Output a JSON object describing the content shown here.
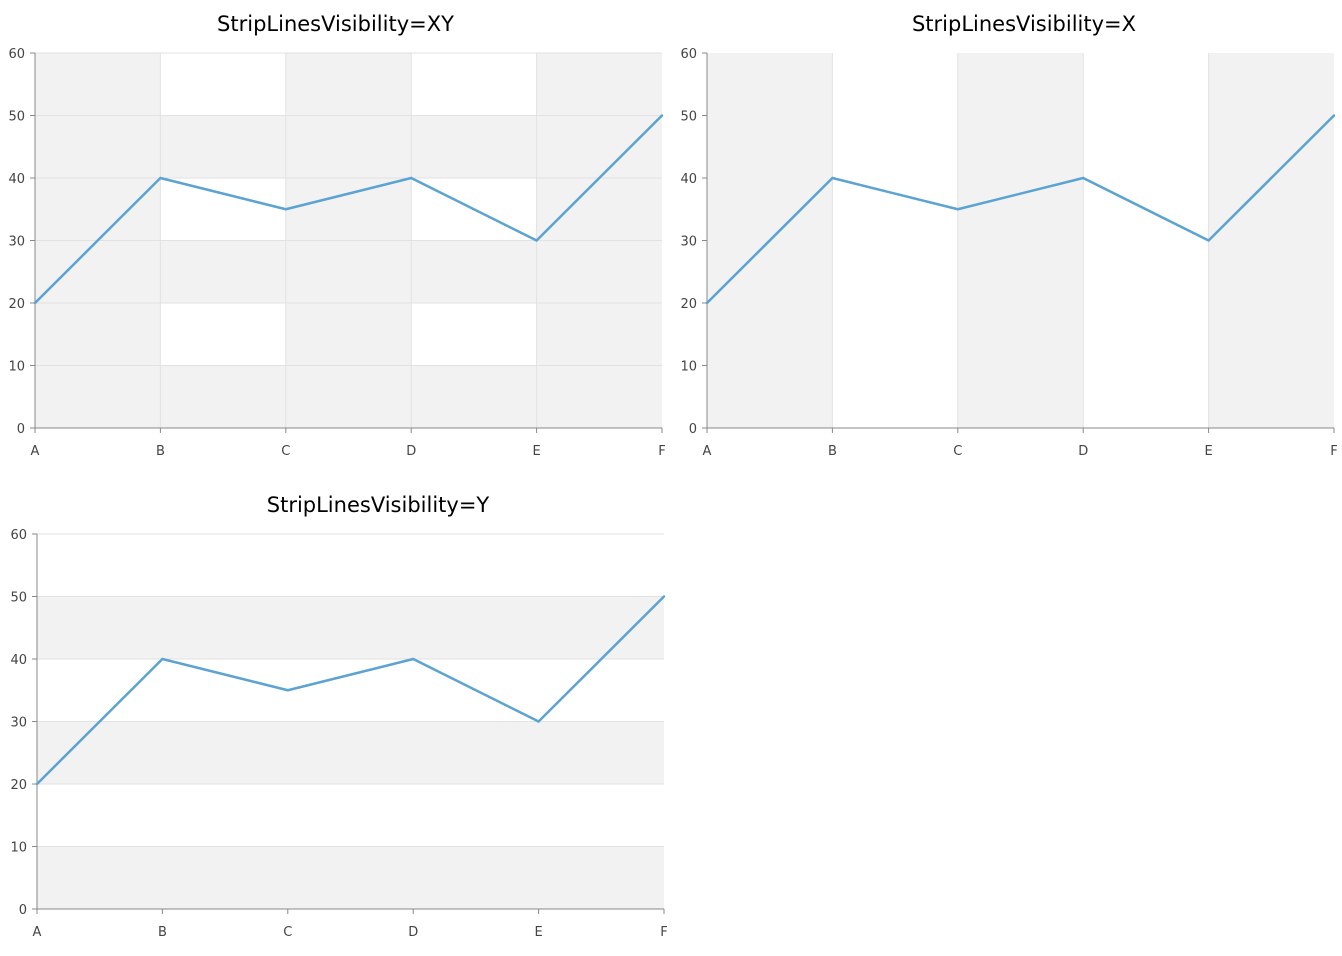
{
  "chart_data": [
    {
      "type": "line",
      "title": "StripLinesVisibility=XY",
      "strip_lines": "XY",
      "categories": [
        "A",
        "B",
        "C",
        "D",
        "E",
        "F"
      ],
      "values": [
        20,
        40,
        35,
        40,
        30,
        50
      ],
      "ylim": [
        0,
        60
      ],
      "yticks": [
        0,
        10,
        20,
        30,
        40,
        50,
        60
      ],
      "xlabel": "",
      "ylabel": "",
      "grid": true
    },
    {
      "type": "line",
      "title": "StripLinesVisibility=X",
      "strip_lines": "X",
      "categories": [
        "A",
        "B",
        "C",
        "D",
        "E",
        "F"
      ],
      "values": [
        20,
        40,
        35,
        40,
        30,
        50
      ],
      "ylim": [
        0,
        60
      ],
      "yticks": [
        0,
        10,
        20,
        30,
        40,
        50,
        60
      ],
      "xlabel": "",
      "ylabel": "",
      "grid": true
    },
    {
      "type": "line",
      "title": "StripLinesVisibility=Y",
      "strip_lines": "Y",
      "categories": [
        "A",
        "B",
        "C",
        "D",
        "E",
        "F"
      ],
      "values": [
        20,
        40,
        35,
        40,
        30,
        50
      ],
      "ylim": [
        0,
        60
      ],
      "yticks": [
        0,
        10,
        20,
        30,
        40,
        50,
        60
      ],
      "xlabel": "",
      "ylabel": "",
      "grid": true
    }
  ],
  "colors": {
    "line": "#5ba3d2",
    "strip": "#f2f2f2",
    "grid": "#e2e2e2",
    "axis": "#888888",
    "tick_text": "#444444"
  }
}
